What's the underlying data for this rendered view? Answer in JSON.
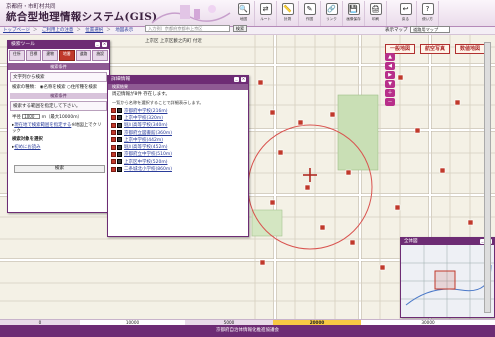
{
  "header": {
    "subtitle": "京都府・市町村共同",
    "title": "統合型地理情報システム(GIS)",
    "tools": [
      {
        "icon": "map-icon",
        "glyph": "🔍",
        "label": "地図"
      },
      {
        "icon": "route-icon",
        "glyph": "⇄",
        "label": "ルート"
      },
      {
        "icon": "measure-icon",
        "glyph": "📏",
        "label": "計測"
      },
      {
        "icon": "draw-icon",
        "glyph": "✎",
        "label": "作図"
      },
      {
        "icon": "link-icon",
        "glyph": "🔗",
        "label": "リンク"
      },
      {
        "icon": "save-icon",
        "glyph": "💾",
        "label": "画像保存"
      },
      {
        "icon": "print-icon",
        "glyph": "🖨",
        "label": "印刷"
      },
      {
        "icon": "back-icon",
        "glyph": "↩",
        "label": "戻る"
      },
      {
        "icon": "help-icon",
        "glyph": "?",
        "label": "使い方"
      }
    ]
  },
  "breadcrumb": {
    "items": [
      "トップページ",
      "ご利用上の注意",
      "位置選択",
      "地図表示"
    ],
    "separator": "＞"
  },
  "map": {
    "search_placeholder": "入力例）京都府京都市上京区",
    "search_button": "検索",
    "location_text": "上京区 上京区藪之内町 付近",
    "display_label": "表示マップ",
    "display_value": "道路用マップ",
    "maptypes": [
      "一般地図",
      "航空写真",
      "数値地図"
    ]
  },
  "search_panel": {
    "title": "検索ツール",
    "tabs": [
      "住所",
      "目標",
      "建物",
      "地番",
      "道路",
      "施設"
    ],
    "section_head": "検索条件",
    "text_search_label": "文字列から検索",
    "search_type_label": "検索の種類",
    "radio_name": "名称を検索",
    "radio_address": "住所種を検索",
    "range_head": "検索条件",
    "range_label": "検索する範囲を指定して下さい。",
    "radius_label": "半径",
    "radius_value": "1000",
    "radius_unit": "ｍ（最大10000ｍ）",
    "nearby_link": "現在地で検索範囲を指定する",
    "nearby_note": "※地図上でクリック",
    "select_head": "検索対象を選択",
    "select_item": "初めにお読み",
    "execute_button": "検索"
  },
  "detail_panel": {
    "title": "詳細情報",
    "subhead": "検索結果",
    "count_note": "周辺情報が8件 存在します。",
    "hint": "一覧から名称を選択することで詳細表示します。",
    "items": [
      "京都府中学校(216m)",
      "上京中学校(320m)",
      "堀川高等学校(340m)",
      "京都府立図書館(360m)",
      "上京中学校(442m)",
      "堀川高等学校(452m)",
      "京都府立中学校(510m)",
      "上京区中学校(520m)",
      "二条城北小学校(860m)"
    ]
  },
  "overview": {
    "title": "全体図"
  },
  "scale": {
    "labels": [
      "0",
      "10000",
      "5000",
      "20000",
      "30000"
    ]
  },
  "footer": {
    "text": "京都府自治体情報化推進協議会"
  },
  "colors": {
    "brand": "#6d2c74",
    "accent": "#c0392b",
    "map_bg": "#f2eee3"
  }
}
